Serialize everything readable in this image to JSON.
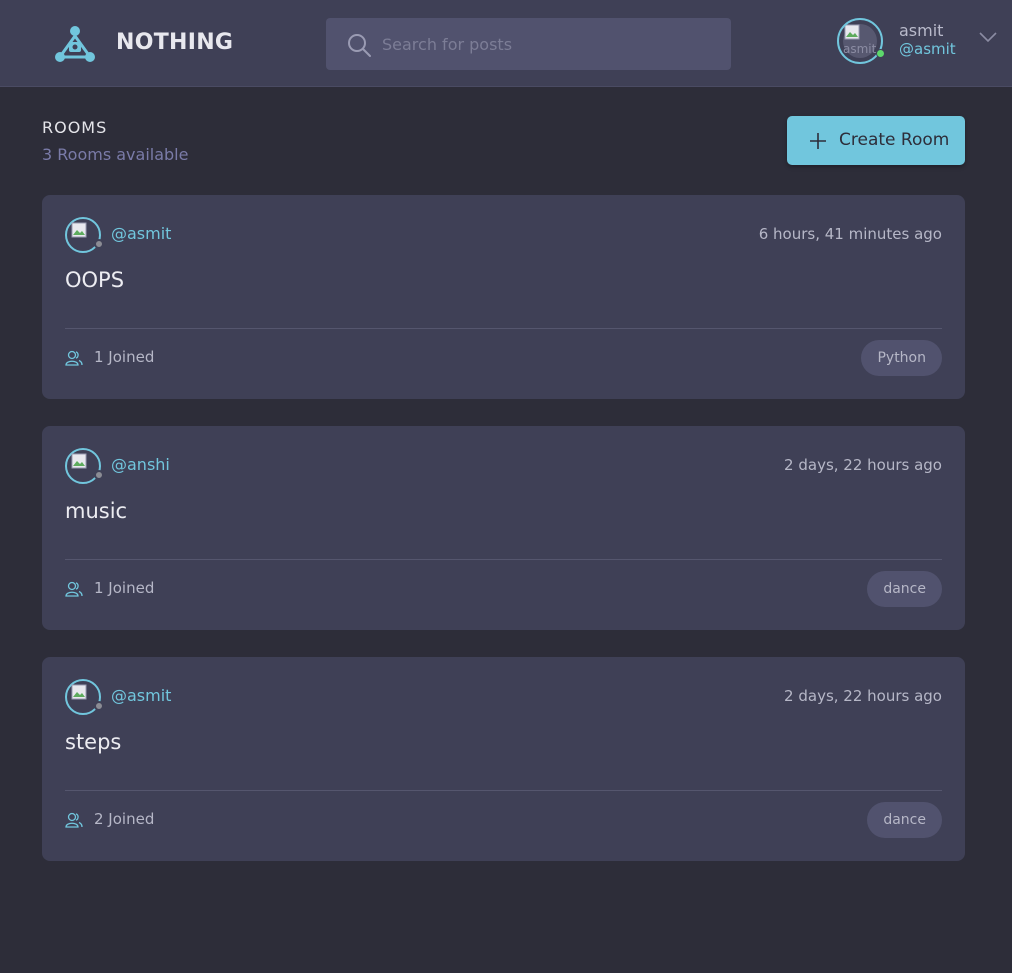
{
  "brand": {
    "name": "NOTHING"
  },
  "search": {
    "placeholder": "Search for posts"
  },
  "user": {
    "name": "asmit",
    "handle": "@asmit",
    "avatar_alt": "asmit"
  },
  "rooms": {
    "title": "ROOMS",
    "count_text": "3 Rooms available",
    "create_label": "Create Room",
    "items": [
      {
        "author": "@asmit",
        "time": "6 hours, 41 minutes ago",
        "name": "OOPS",
        "joined": "1 Joined",
        "tag": "Python"
      },
      {
        "author": "@anshi",
        "time": "2 days, 22 hours ago",
        "name": "music",
        "joined": "1 Joined",
        "tag": "dance"
      },
      {
        "author": "@asmit",
        "time": "2 days, 22 hours ago",
        "name": "steps",
        "joined": "2 Joined",
        "tag": "dance"
      }
    ]
  },
  "colors": {
    "accent": "#71c6dd",
    "background": "#2d2d39",
    "card": "#3f4056",
    "online": "#5dd96c"
  }
}
